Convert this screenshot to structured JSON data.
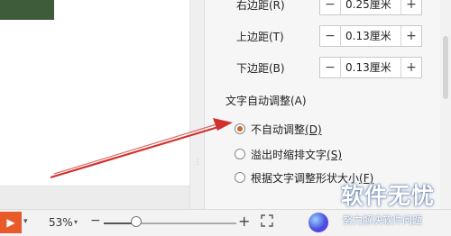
{
  "margins": [
    {
      "label": "右边距(R)",
      "value": "0.25厘米"
    },
    {
      "label": "上边距(T)",
      "value": "0.13厘米"
    },
    {
      "label": "下边距(B)",
      "value": "0.13厘米"
    }
  ],
  "stepper": {
    "minus": "−",
    "plus": "+"
  },
  "autofit": {
    "title": "文字自动调整(A)",
    "options": [
      {
        "label": "不自动调整",
        "key": "(D)",
        "checked": true
      },
      {
        "label": "溢出时缩排文字",
        "key": "(S)",
        "checked": false
      },
      {
        "label": "根据文字调整形状大小",
        "key": "(F)",
        "checked": false
      }
    ]
  },
  "statusbar": {
    "play_icon": "play-icon",
    "zoom": "53%",
    "zoom_percent": 25,
    "zoom_minus": "−",
    "zoom_plus": "+"
  },
  "watermark": {
    "title": "软件无忧",
    "subtitle": "努力解决软件问题"
  },
  "colors": {
    "accent": "#c56a2a",
    "arrow": "#d0312d",
    "play": "#e85a2a"
  }
}
